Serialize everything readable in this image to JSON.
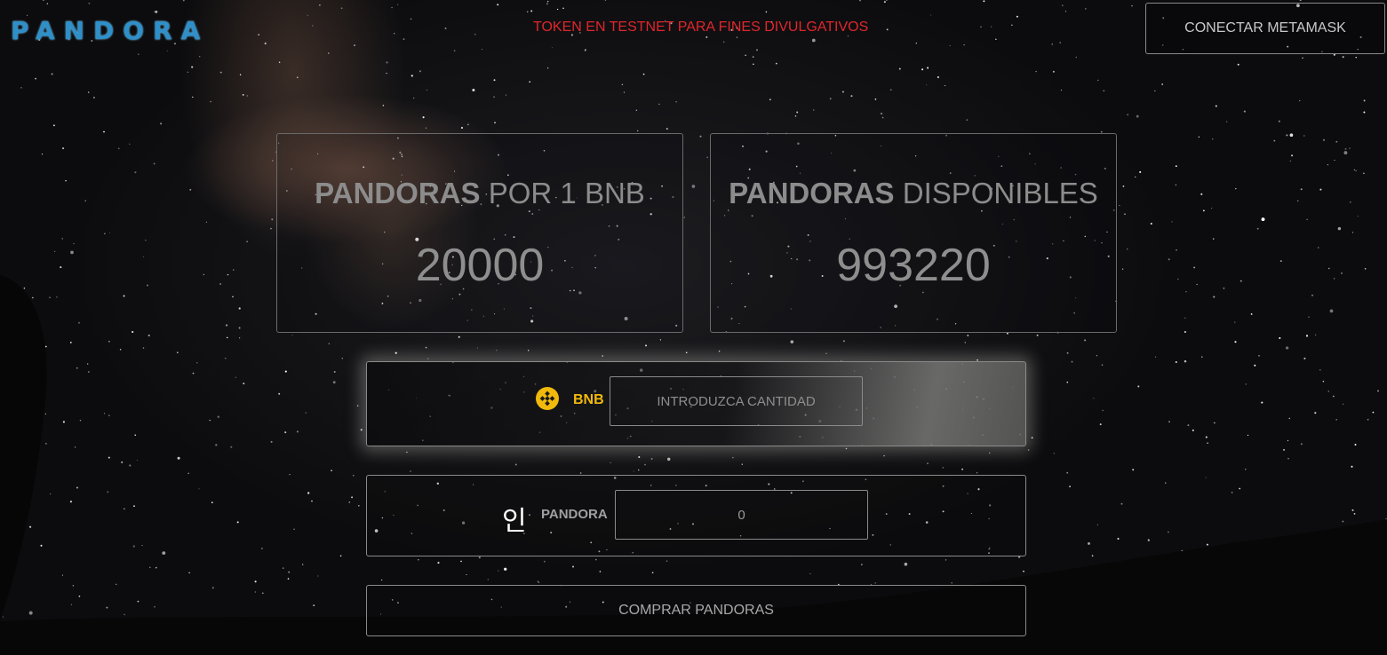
{
  "header": {
    "logo_text": "PANDORA",
    "notice": "TOKEN EN TESTNET PARA FINES DIVULGATIVOS",
    "connect_button": "CONECTAR METAMASK"
  },
  "stats": {
    "rate": {
      "title_bold": "PANDORAS",
      "title_rest": " POR 1 BNB",
      "value": "20000"
    },
    "available": {
      "title_bold": "PANDORAS",
      "title_rest": " DISPONIBLES",
      "value": "993220"
    }
  },
  "swap": {
    "bnb": {
      "icon": "bnb-coin-icon",
      "label": "BNB",
      "placeholder": "INTRODUZCA CANTIDAD"
    },
    "pandora": {
      "icon": "pandora-symbol-icon",
      "symbol": "인",
      "label": "PANDORA",
      "value": "0"
    },
    "buy_button": "COMPRAR PANDORAS"
  },
  "colors": {
    "notice": "#e0262b",
    "bnb_accent": "#f0b90b",
    "logo": "#2f8fc8"
  }
}
